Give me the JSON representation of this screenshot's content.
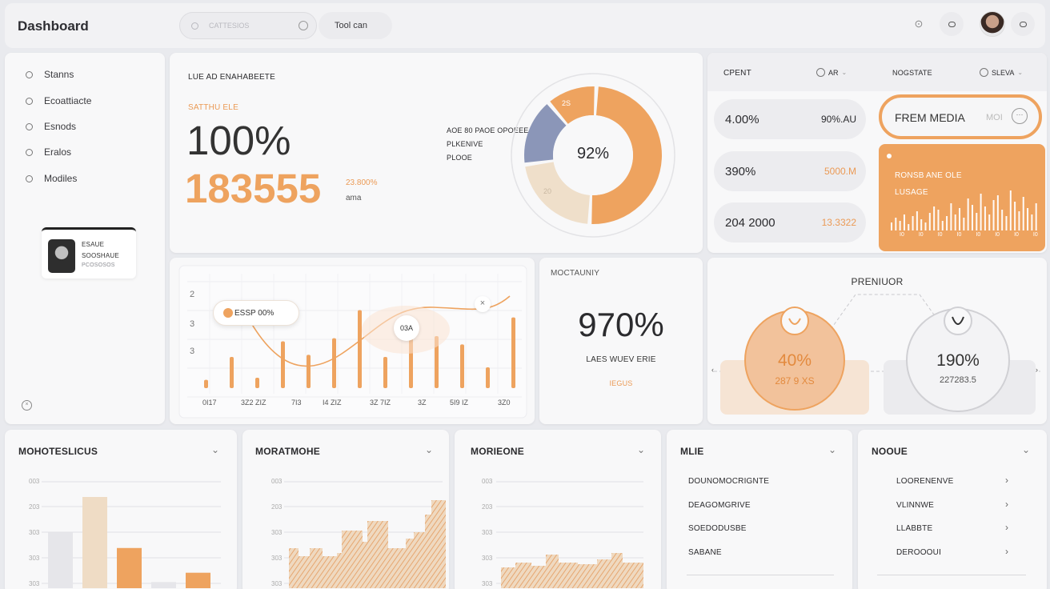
{
  "header": {
    "title": "Dashboard",
    "search_placeholder": "CATTESIOS",
    "tool_label": "Tool can"
  },
  "sidebar": {
    "items": [
      {
        "label": "Stanns"
      },
      {
        "label": "Ecoattiacte"
      },
      {
        "label": "Esnods"
      },
      {
        "label": "Eralos"
      },
      {
        "label": "Modiles"
      }
    ],
    "profile": {
      "line1": "ESAUE",
      "line2": "SOOSHAUE",
      "line3": "PCOSOSOS"
    }
  },
  "hero": {
    "title": "LUE AD ENAHABEETE",
    "subtitle": "SATTHU ELE",
    "big_percent": "100%",
    "big_number": "183555",
    "delta": "23.800%",
    "delta_label": "ama",
    "donut_caption": [
      "AOE 80 PAOE OPOEEE",
      "PLKENIVE",
      "PLOOE"
    ],
    "donut_center": "92%",
    "donut_seg_label_top": "2S",
    "donut_seg_label_bottom": "20"
  },
  "donut_data": {
    "segments": [
      {
        "value": 50,
        "color": "#eea35f"
      },
      {
        "value": 22,
        "color": "#efdfca"
      },
      {
        "value": 16,
        "color": "#8b96b8"
      },
      {
        "value": 12,
        "color": "#eea35f"
      }
    ]
  },
  "right_panel": {
    "col1_title": "CPENT",
    "col1_toggle": "AR",
    "col2_title": "NOGSTATE",
    "col2_toggle": "SLEVA",
    "rows": [
      {
        "left": "4.00%",
        "right": "90%.AU",
        "right_color": "#2b2b2e"
      },
      {
        "left": "390%",
        "right": "5000.M",
        "right_color": "#eb9a55"
      },
      {
        "left": "204 2000",
        "right": "13.3322",
        "right_color": "#eb9a55"
      }
    ],
    "media_button": "FREM MEDIA",
    "media_more": "MOI",
    "orange_card_line1": "RONSB ANE OLE",
    "orange_card_line2": "LUSAGE",
    "orange_card_axis": [
      "I0",
      "I0",
      "I0",
      "I0",
      "I0",
      "I0",
      "I0",
      "I0"
    ]
  },
  "line_chart": {
    "type": "bar",
    "y_ticks": [
      "2",
      "3",
      "3"
    ],
    "x_labels": [
      "0I17",
      "3Z2 ZIZ",
      "7I3",
      "I4 ZIZ",
      "3Z 7IZ",
      "3Z",
      "5I9 IZ",
      "3Z0"
    ],
    "tooltip": "ESSP 00%",
    "point_label": "03A",
    "bar_values": [
      8,
      30,
      10,
      45,
      32,
      48,
      75,
      30,
      52,
      50,
      42,
      20,
      68,
      95
    ]
  },
  "metric_card": {
    "title": "MOCTAUNIY",
    "value": "970%",
    "caption": "LAES WUEV ERIE",
    "sub": "IEGUS"
  },
  "premium": {
    "title": "PRENIUOR",
    "left_value": "40%",
    "left_sub": "287 9 XS",
    "right_value": "190%",
    "right_sub": "227283.5"
  },
  "bottom_panels": [
    {
      "title": "MOHOTESLICUS",
      "ticks": [
        "003",
        "203",
        "303",
        "303",
        "303"
      ]
    },
    {
      "title": "MORATMOHE",
      "ticks": [
        "003",
        "203",
        "303",
        "303",
        "303"
      ]
    },
    {
      "title": "MORIEONE",
      "ticks": [
        "003",
        "203",
        "303",
        "303",
        "303"
      ]
    }
  ],
  "bottom_bar_chart": {
    "type": "bar",
    "values": [
      72,
      118,
      52,
      8,
      20
    ],
    "colors": [
      "#e6e6ea",
      "#efdcc5",
      "#eea35f",
      "#e6e6ea",
      "#eea35f"
    ]
  },
  "list_panel_1": {
    "title": "MLIE",
    "items": [
      "DOUNOMOCRIGNTE",
      "DEAGOMGRIVE",
      "SOEDODUSBE",
      "SABANE"
    ]
  },
  "list_panel_2": {
    "title": "NOOUE",
    "items": [
      "LOORENENVE",
      "VLINNWE",
      "LLABBTE",
      "DEROOOUI"
    ]
  }
}
